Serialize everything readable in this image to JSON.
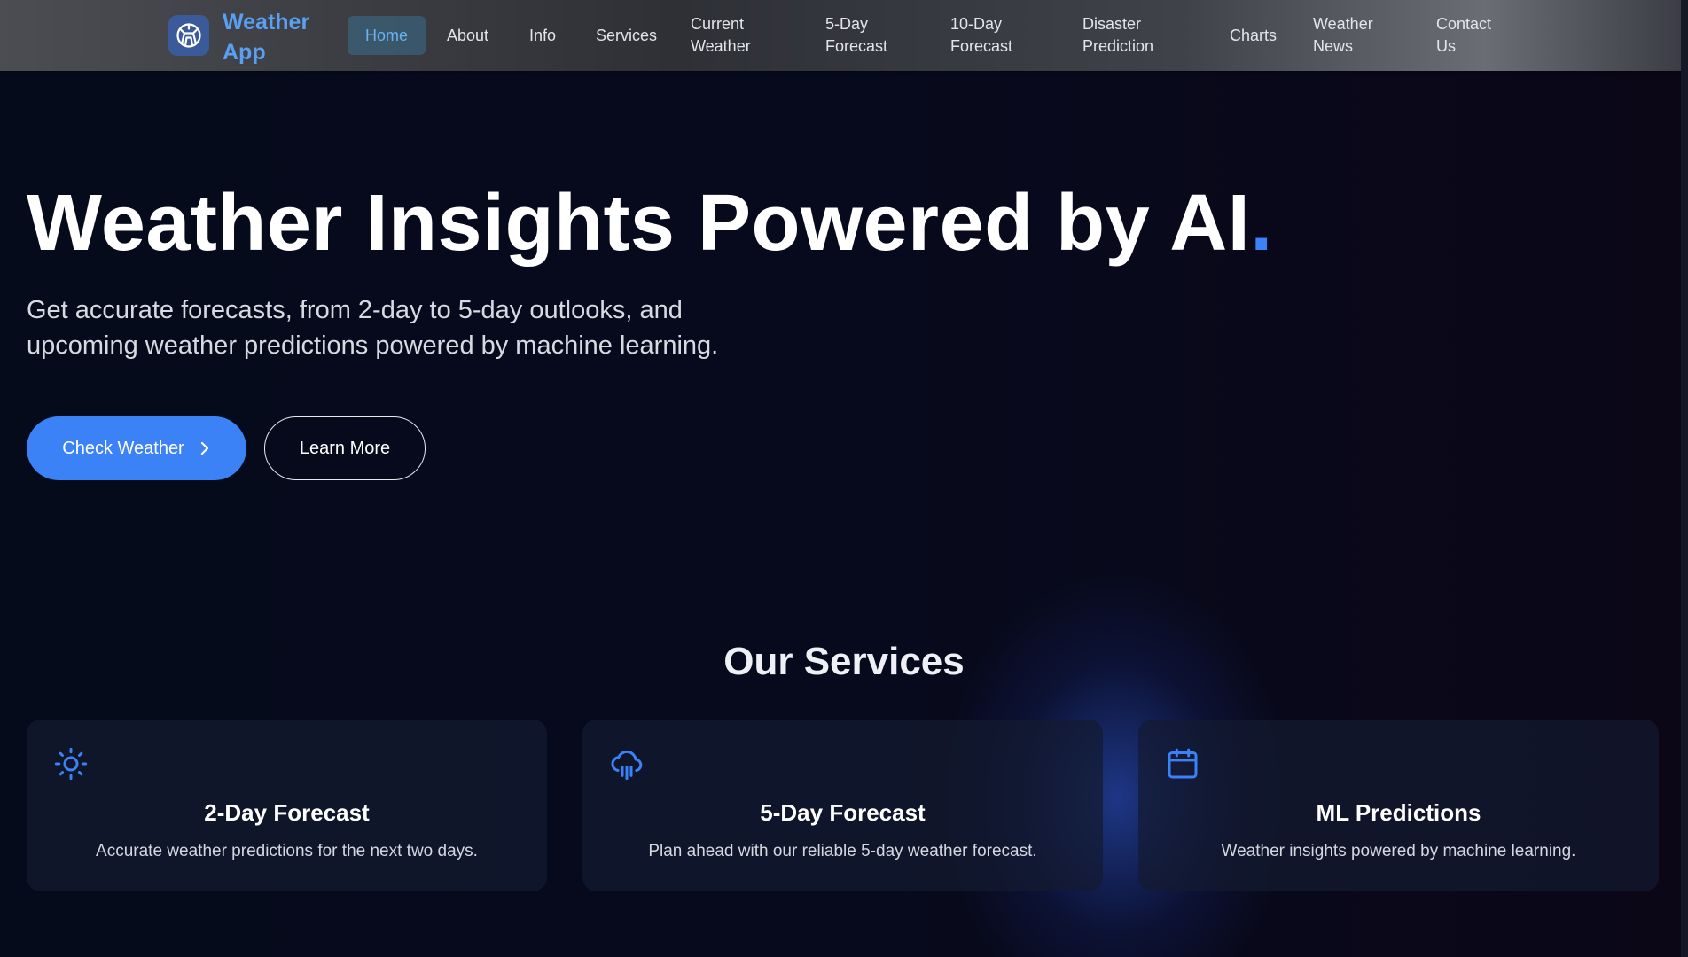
{
  "app": {
    "name": "Weather App"
  },
  "nav": {
    "items": [
      {
        "label": "Home",
        "active": true
      },
      {
        "label": "About"
      },
      {
        "label": "Info"
      },
      {
        "label": "Services"
      },
      {
        "label": "Current Weather"
      },
      {
        "label": "5-Day Forecast"
      },
      {
        "label": "10-Day Forecast"
      },
      {
        "label": "Disaster Prediction"
      },
      {
        "label": "Charts"
      },
      {
        "label": "Weather News"
      },
      {
        "label": "Contact Us"
      }
    ]
  },
  "hero": {
    "title": "Weather Insights Powered by AI",
    "title_dot": ".",
    "subtitle": "Get accurate forecasts, from 2-day to 5-day outlooks, and upcoming weather predictions powered by machine learning.",
    "primary_button": "Check Weather",
    "secondary_button": "Learn More"
  },
  "services": {
    "title": "Our Services",
    "cards": [
      {
        "icon": "sun-icon",
        "title": "2-Day Forecast",
        "description": "Accurate weather predictions for the next two days."
      },
      {
        "icon": "cloud-rain-icon",
        "title": "5-Day Forecast",
        "description": "Plan ahead with our reliable 5-day weather forecast."
      },
      {
        "icon": "calendar-icon",
        "title": "ML Predictions",
        "description": "Weather insights powered by machine learning."
      }
    ]
  },
  "colors": {
    "accent": "#3b82f6",
    "logo_text": "#5aa0f2",
    "background": "#070a1a",
    "card_background": "#141a30"
  }
}
